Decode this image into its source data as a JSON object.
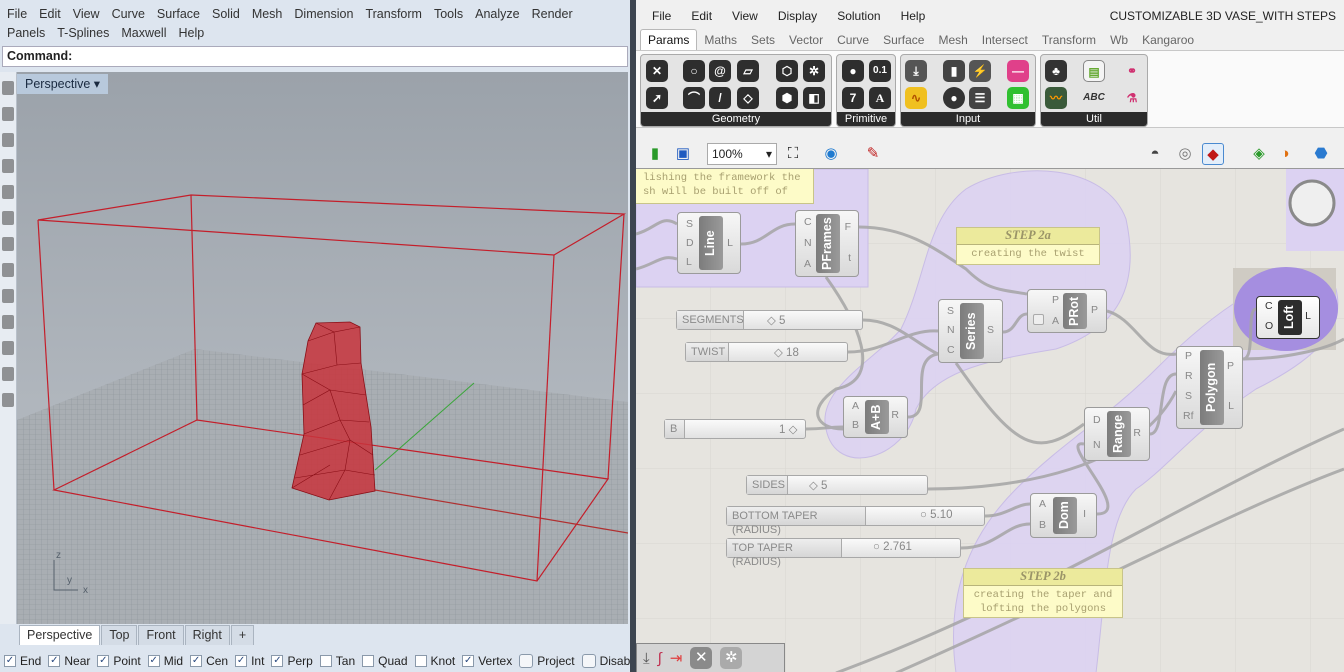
{
  "rhino": {
    "menu": [
      "File",
      "Edit",
      "View",
      "Curve",
      "Surface",
      "Solid",
      "Mesh",
      "Dimension",
      "Transform",
      "Tools",
      "Analyze",
      "Render",
      "Panels",
      "T-Splines",
      "Maxwell",
      "Help"
    ],
    "command_label": "Command:",
    "viewport_title": "Perspective",
    "axis_labels": {
      "z": "z",
      "y": "y",
      "x": "x"
    },
    "view_tabs": [
      "Perspective",
      "Top",
      "Front",
      "Right",
      "+"
    ],
    "active_view_tab": "Perspective",
    "snaps": [
      {
        "label": "End",
        "checked": true
      },
      {
        "label": "Near",
        "checked": true
      },
      {
        "label": "Point",
        "checked": true
      },
      {
        "label": "Mid",
        "checked": true
      },
      {
        "label": "Cen",
        "checked": true
      },
      {
        "label": "Int",
        "checked": true
      },
      {
        "label": "Perp",
        "checked": true
      },
      {
        "label": "Tan",
        "checked": false
      },
      {
        "label": "Quad",
        "checked": false
      },
      {
        "label": "Knot",
        "checked": false
      },
      {
        "label": "Vertex",
        "checked": true
      }
    ],
    "toggles": [
      "Project",
      "Disable"
    ],
    "colors": {
      "geometry": "#c41e2a",
      "grid": "#8f959c",
      "y_axis": "#3aa63a"
    }
  },
  "gh": {
    "menu": [
      "File",
      "Edit",
      "View",
      "Display",
      "Solution",
      "Help"
    ],
    "title": "CUSTOMIZABLE 3D VASE_WITH STEPS",
    "tabs": [
      "Params",
      "Maths",
      "Sets",
      "Vector",
      "Curve",
      "Surface",
      "Mesh",
      "Intersect",
      "Transform",
      "Wb",
      "Kangaroo"
    ],
    "active_tab": "Params",
    "panels": [
      "Geometry",
      "Primitive",
      "Input",
      "Util"
    ],
    "primitive_glyphs": [
      "0.1",
      "7",
      "A"
    ],
    "util_text": "ABC",
    "zoom": "100%",
    "notes": {
      "top": [
        "lishing the framework the",
        "sh will be built off of"
      ],
      "step2a": {
        "title": "STEP 2a",
        "body": "creating the twist"
      },
      "step2b": {
        "title": "STEP 2b",
        "body": [
          "creating the taper and",
          "lofting the polygons"
        ]
      }
    },
    "components": {
      "line": {
        "name": "Line",
        "inputs": [
          "S",
          "D",
          "L"
        ],
        "outputs": [
          "L"
        ]
      },
      "pframes": {
        "name": "PFrames",
        "inputs": [
          "C",
          "N",
          "A"
        ],
        "outputs": [
          "F",
          "t"
        ]
      },
      "series": {
        "name": "Series",
        "inputs": [
          "S",
          "N",
          "C"
        ],
        "outputs": [
          "S"
        ]
      },
      "prot": {
        "name": "PRot",
        "inputs": [
          "P",
          "A"
        ],
        "outputs": [
          "P"
        ]
      },
      "addition": {
        "name": "A+B",
        "inputs": [
          "A",
          "B"
        ],
        "outputs": [
          "R"
        ]
      },
      "range": {
        "name": "Range",
        "inputs": [
          "D",
          "N"
        ],
        "outputs": [
          "R"
        ]
      },
      "polygon": {
        "name": "Polygon",
        "inputs": [
          "P",
          "R",
          "S",
          "Rf"
        ],
        "outputs": [
          "P",
          "L"
        ]
      },
      "loft": {
        "name": "Loft",
        "inputs": [
          "C",
          "O"
        ],
        "outputs": [
          "L"
        ]
      },
      "domain": {
        "name": "Dom",
        "inputs": [
          "A",
          "B"
        ],
        "outputs": [
          "I"
        ]
      }
    },
    "sliders": {
      "segments": {
        "label": "SEGMENTS",
        "value": "5"
      },
      "twist": {
        "label": "TWIST",
        "value": "18"
      },
      "b": {
        "label": "B",
        "value": "1"
      },
      "sides": {
        "label": "SIDES",
        "value": "5"
      },
      "bottom_taper": {
        "label": "BOTTOM TAPER (RADIUS)",
        "value": "5.10"
      },
      "top_taper": {
        "label": "TOP TAPER (RADIUS)",
        "value": "2.761"
      }
    },
    "colors": {
      "group": "#d9d0f0",
      "canvas": "#e6e4df",
      "note": "#fdfbc8",
      "selected_group": "#a58ee0"
    }
  }
}
